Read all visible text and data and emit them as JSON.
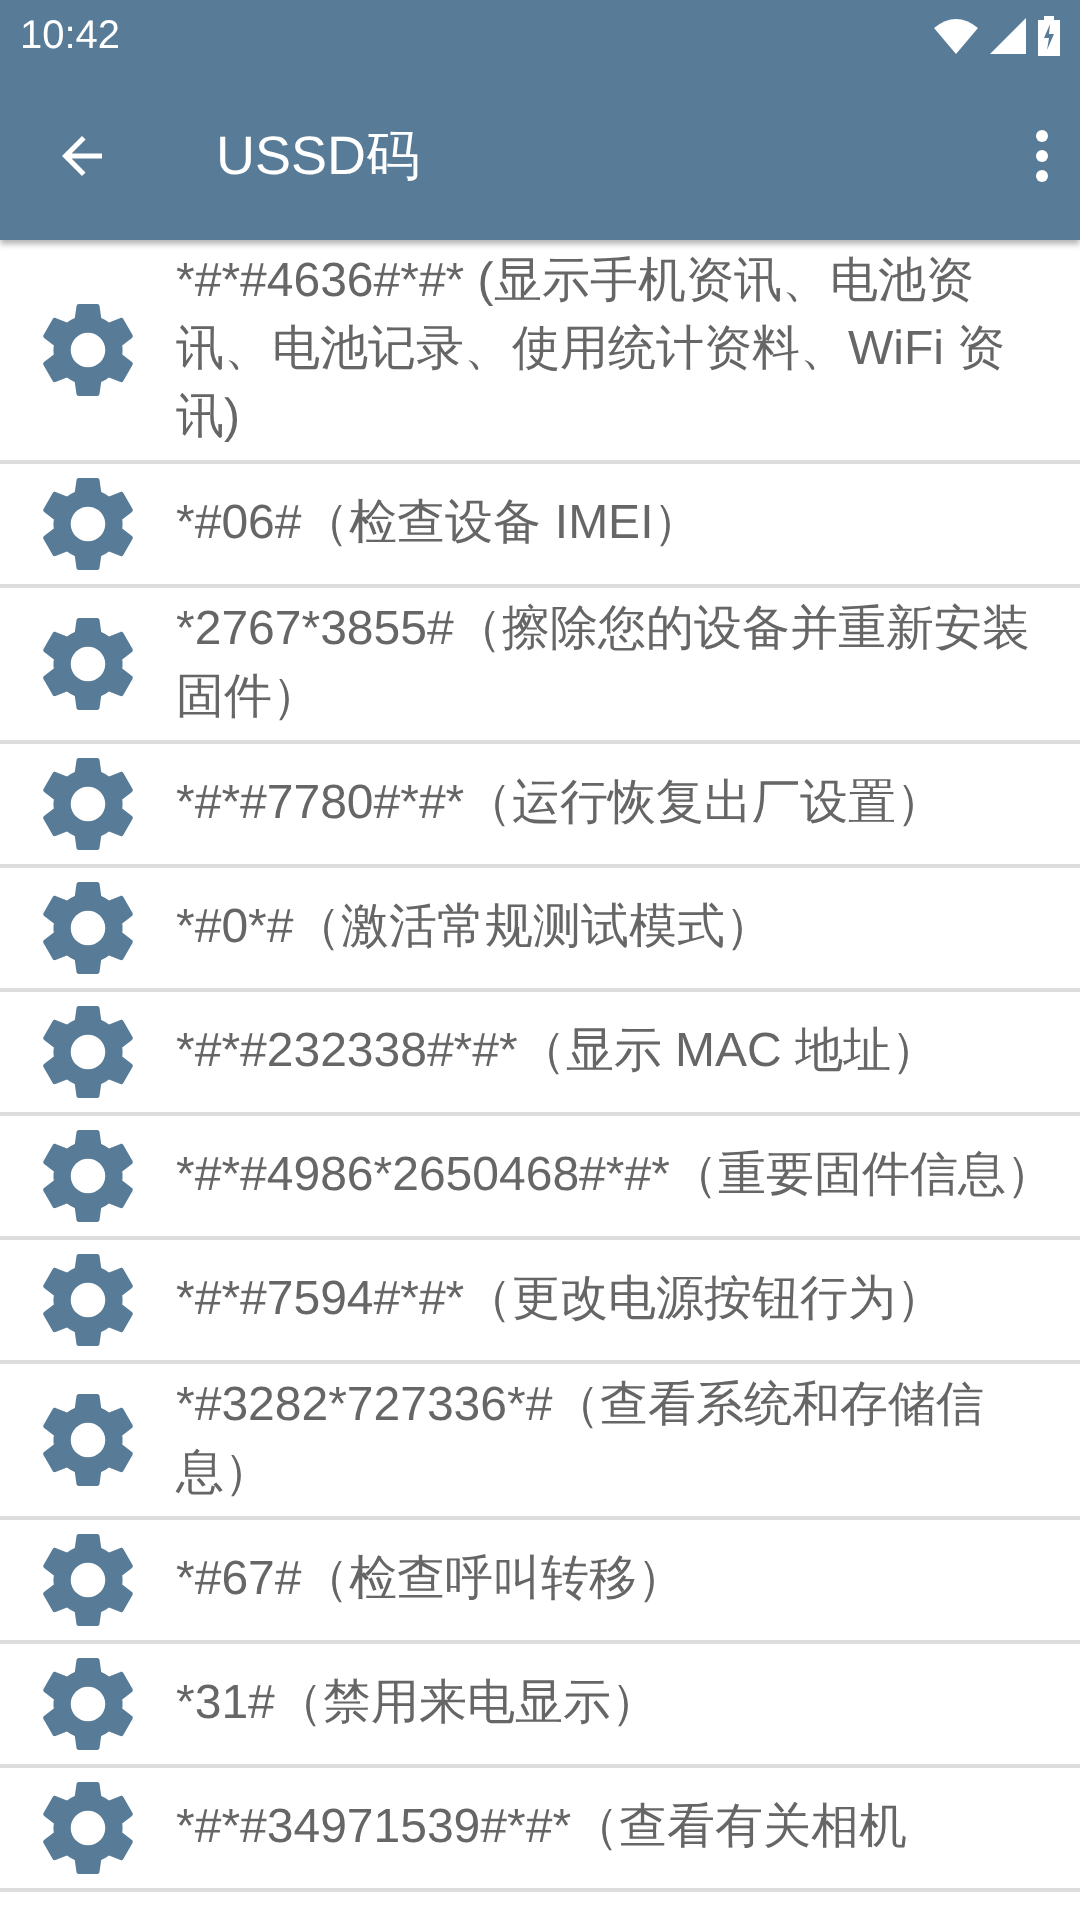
{
  "status_bar": {
    "time": "10:42"
  },
  "app_bar": {
    "title": "USSD码"
  },
  "items": [
    {
      "text": "*#*#4636#*#* (显示手机资讯、电池资讯、电池记录、使用统计资料、WiFi 资讯)"
    },
    {
      "text": "*#06#（检查设备 IMEI）"
    },
    {
      "text": "*2767*3855#（擦除您的设备并重新安装固件）"
    },
    {
      "text": "*#*#7780#*#*（运行恢复出厂设置）"
    },
    {
      "text": "*#0*#（激活常规测试模式）"
    },
    {
      "text": "*#*#232338#*#*（显示 MAC 地址）"
    },
    {
      "text": "*#*#4986*2650468#*#*（重要固件信息）"
    },
    {
      "text": "*#*#7594#*#*（更改电源按钮行为）"
    },
    {
      "text": "*#3282*727336*#（查看系统和存储信息）"
    },
    {
      "text": "*#67#（检查呼叫转移）"
    },
    {
      "text": "*31#（禁用来电显示）"
    },
    {
      "text": "*#*#34971539#*#*（查看有关相机"
    }
  ]
}
